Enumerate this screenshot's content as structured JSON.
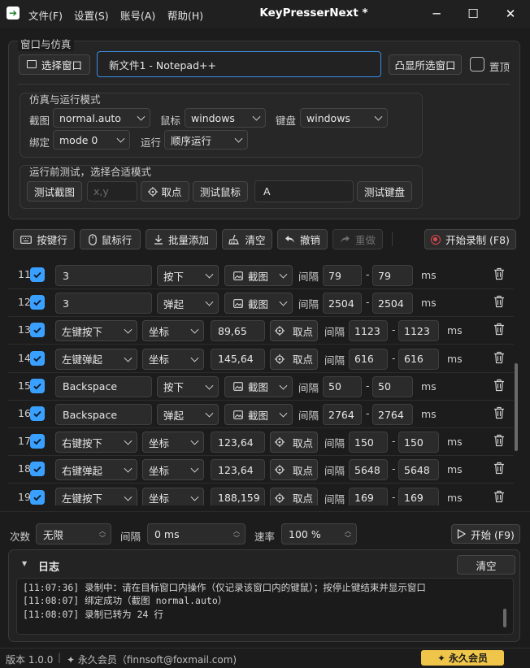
{
  "window": {
    "title": "KeyPresserNext *",
    "min_label": "─",
    "max_label": "☐",
    "close_label": "✕"
  },
  "menu": [
    "文件(F)",
    "设置(S)",
    "账号(A)",
    "帮助(H)"
  ],
  "target": {
    "group_title": "窗口与仿真",
    "select_window_label": "选择窗口",
    "window_value": "新文件1 - Notepad++",
    "highlight_label": "凸显所选窗口",
    "pin_label": "置顶",
    "pin_checked": false
  },
  "sim": {
    "group_title": "仿真与运行模式",
    "screenshot_label": "截图",
    "screenshot_value": "normal.auto",
    "mouse_label": "鼠标",
    "mouse_value": "windows",
    "keyboard_label": "键盘",
    "keyboard_value": "windows",
    "bind_label": "绑定",
    "bind_value": "mode 0",
    "run_label": "运行",
    "run_value": "顺序运行"
  },
  "pretest": {
    "group_title": "运行前测试，选择合适模式",
    "test_screenshot_label": "测试截图",
    "xy_placeholder": "x,y",
    "pick_label": "取点",
    "test_mouse_label": "测试鼠标",
    "key_value": "A",
    "test_keyboard_label": "测试键盘"
  },
  "toolbar": {
    "key_row": "按键行",
    "mouse_row": "鼠标行",
    "batch_add": "批量添加",
    "clear": "清空",
    "undo": "撤销",
    "redo": "重做",
    "record": "开始录制 (F8)"
  },
  "rows": [
    {
      "num": "11",
      "kind": "key",
      "value": "3",
      "action": "按下",
      "mode": "截图",
      "interval_label": "间隔",
      "min": "79",
      "max": "79",
      "unit": "ms"
    },
    {
      "num": "12",
      "kind": "key",
      "value": "3",
      "action": "弹起",
      "mode": "截图",
      "interval_label": "间隔",
      "min": "2504",
      "max": "2504",
      "unit": "ms"
    },
    {
      "num": "13",
      "kind": "mouse",
      "value": "左键按下",
      "coord_mode": "坐标",
      "coord": "89,65",
      "pick": "取点",
      "interval_label": "间隔",
      "min": "1123",
      "max": "1123",
      "unit": "ms"
    },
    {
      "num": "14",
      "kind": "mouse",
      "value": "左键弹起",
      "coord_mode": "坐标",
      "coord": "145,64",
      "pick": "取点",
      "interval_label": "间隔",
      "min": "616",
      "max": "616",
      "unit": "ms"
    },
    {
      "num": "15",
      "kind": "key",
      "value": "Backspace",
      "action": "按下",
      "mode": "截图",
      "interval_label": "间隔",
      "min": "50",
      "max": "50",
      "unit": "ms"
    },
    {
      "num": "16",
      "kind": "key",
      "value": "Backspace",
      "action": "弹起",
      "mode": "截图",
      "interval_label": "间隔",
      "min": "2764",
      "max": "2764",
      "unit": "ms"
    },
    {
      "num": "17",
      "kind": "mouse",
      "value": "右键按下",
      "coord_mode": "坐标",
      "coord": "123,64",
      "pick": "取点",
      "interval_label": "间隔",
      "min": "150",
      "max": "150",
      "unit": "ms"
    },
    {
      "num": "18",
      "kind": "mouse",
      "value": "右键弹起",
      "coord_mode": "坐标",
      "coord": "123,64",
      "pick": "取点",
      "interval_label": "间隔",
      "min": "5648",
      "max": "5648",
      "unit": "ms"
    },
    {
      "num": "19",
      "kind": "mouse",
      "value": "左键按下",
      "coord_mode": "坐标",
      "coord": "188,159",
      "pick": "取点",
      "interval_label": "间隔",
      "min": "169",
      "max": "169",
      "unit": "ms"
    }
  ],
  "run": {
    "count_label": "次数",
    "count_value": "无限",
    "interval_label": "间隔",
    "interval_value": "0 ms",
    "speed_label": "速率",
    "speed_value": "100 %",
    "start_label": "开始 (F9)"
  },
  "log": {
    "title": "日志",
    "clear_label": "清空",
    "lines": [
      "[11:07:36] 录制中：请在目标窗口内操作（仅记录该窗口内的键鼠）；按停止键结束并显示窗口",
      "[11:08:07] 绑定成功（截图 normal.auto）",
      "[11:08:07] 录制已转为 24 行"
    ]
  },
  "status": {
    "version": "版本 1.0.0",
    "member": "✦ 永久会员（finnsoft@foxmail.com)",
    "badge": "永久会员"
  },
  "colors": {
    "accent": "#3aa0ff",
    "record": "#e0474c",
    "badge": "#f0c64a"
  }
}
